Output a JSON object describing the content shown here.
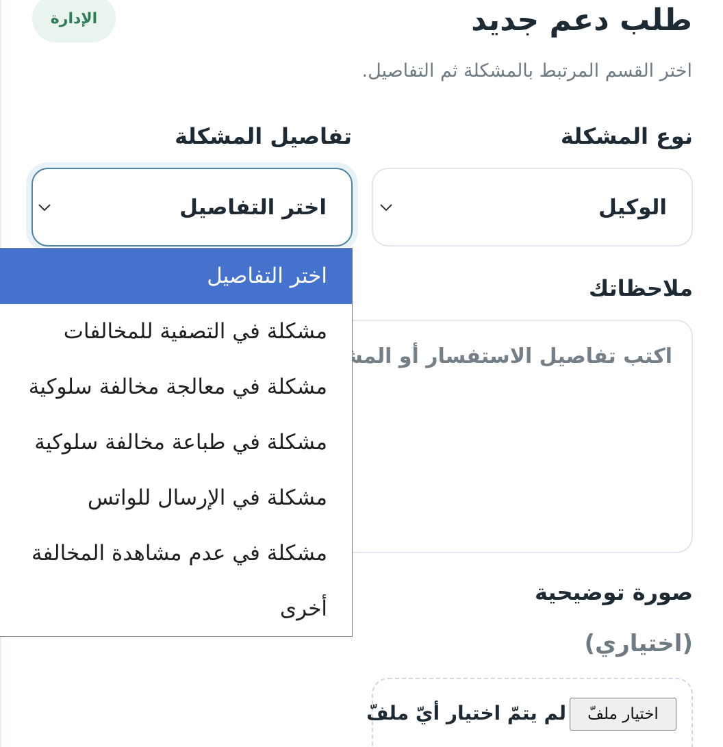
{
  "header": {
    "title": "طلب دعم جديد",
    "subtitle": "اختر القسم المرتبط بالمشكلة ثم التفاصيل.",
    "badge": "الإدارة"
  },
  "form": {
    "problem_type": {
      "label": "نوع المشكلة",
      "value": "الوكيل"
    },
    "problem_details": {
      "label": "تفاصيل المشكلة",
      "value": "اختر التفاصيل",
      "options": [
        "اختر التفاصيل",
        "مشكلة في التصفية للمخالفات",
        "مشكلة في معالجة مخالفة سلوكية",
        "مشكلة في طباعة مخالفة سلوكية",
        "مشكلة في الإرسال للواتس",
        "مشكلة في عدم مشاهدة المخالفة",
        "أخرى"
      ],
      "selected_index": 0
    },
    "notes": {
      "label": "ملاحظاتك",
      "placeholder": "اكتب تفاصيل الاستفسار أو المشكلة"
    },
    "image": {
      "label": "صورة توضيحية",
      "optional": "(اختياري)",
      "button": "اختيار ملفّ",
      "status": "لم يتمّ اختيار أيّ ملفّ"
    }
  },
  "icons": {
    "select_arrow": "chevron-down-icon"
  },
  "colors": {
    "accent": "#4472cc",
    "badge_bg": "#e9f4ee",
    "badge_text": "#2f7d55",
    "focus_border": "#4f86a8"
  }
}
